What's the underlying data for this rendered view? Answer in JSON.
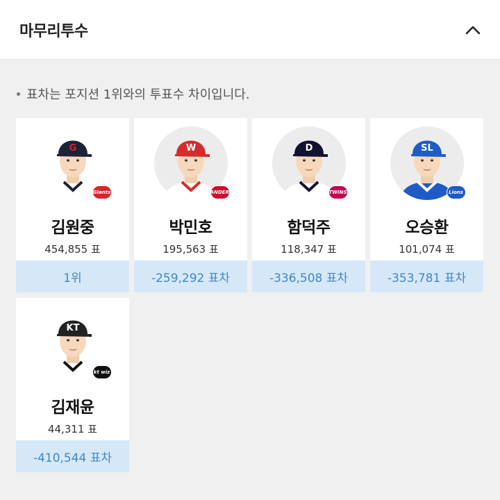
{
  "header": {
    "title": "마무리투수"
  },
  "note": "표차는 포지션 1위와의 투표수 차이입니다.",
  "players": [
    {
      "name": "김원중",
      "votes": "454,855 표",
      "diff": "1위",
      "cap_color": "#1c2338",
      "cap_letter": "G",
      "letter_color": "#d8232a",
      "jersey": "#ffffff",
      "jersey_trim": "#1c2338",
      "logo_text": "Giants",
      "logo_color": "#d8232a"
    },
    {
      "name": "박민호",
      "votes": "195,563 표",
      "diff": "-259,292 표차",
      "cap_color": "#d52b2b",
      "cap_letter": "W",
      "letter_color": "#ffffff",
      "jersey": "#ffffff",
      "jersey_trim": "#d52b2b",
      "logo_text": "LANDERS",
      "logo_color": "#ce0e2d"
    },
    {
      "name": "함덕주",
      "votes": "118,347 표",
      "diff": "-336,508 표차",
      "cap_color": "#131230",
      "cap_letter": "D",
      "letter_color": "#ffffff",
      "jersey": "#ffffff",
      "jersey_trim": "#131230",
      "logo_text": "TWINS",
      "logo_color": "#c30452"
    },
    {
      "name": "오승환",
      "votes": "101,074 표",
      "diff": "-353,781 표차",
      "cap_color": "#1e5bc6",
      "cap_letter": "SL",
      "letter_color": "#ffffff",
      "jersey": "#1e5bc6",
      "jersey_trim": "#ffffff",
      "logo_text": "Lions",
      "logo_color": "#1e5bc6"
    },
    {
      "name": "김재윤",
      "votes": "44,311 표",
      "diff": "-410,544 표차",
      "cap_color": "#222222",
      "cap_letter": "KT",
      "letter_color": "#ffffff",
      "jersey": "#ffffff",
      "jersey_trim": "#111111",
      "logo_text": "kt wiz",
      "logo_color": "#111111"
    }
  ]
}
